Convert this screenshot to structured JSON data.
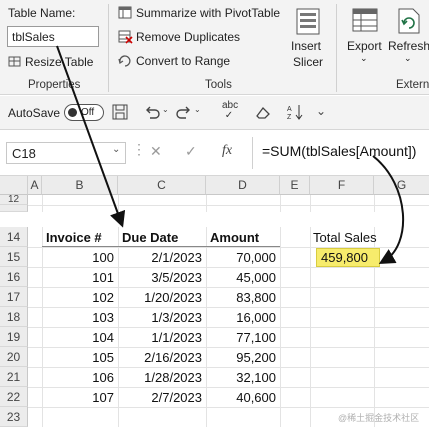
{
  "ribbon": {
    "table_name_label": "Table Name:",
    "table_name_value": "tblSales",
    "resize_table": "Resize Table",
    "properties_group": "Properties",
    "summarize_pivot": "Summarize with PivotTable",
    "remove_duplicates": "Remove Duplicates",
    "convert_to_range": "Convert to Range",
    "tools_group": "Tools",
    "insert_slicer_1": "Insert",
    "insert_slicer_2": "Slicer",
    "export": "Export",
    "refresh": "Refresh",
    "extern_group": "Extern"
  },
  "qat": {
    "autosave_label": "AutoSave",
    "autosave_state": "Off"
  },
  "formula_bar": {
    "name_box": "C18",
    "fx": "fx",
    "formula": "=SUM(tblSales[Amount])"
  },
  "columns": [
    "A",
    "B",
    "C",
    "D",
    "E",
    "F",
    "G"
  ],
  "row_numbers": [
    "12",
    "14",
    "15",
    "16",
    "17",
    "18",
    "19",
    "20",
    "21",
    "22",
    "23"
  ],
  "table": {
    "headers": [
      "Invoice #",
      "Due Date",
      "Amount"
    ],
    "rows": [
      [
        "100",
        "2/1/2023",
        "70,000"
      ],
      [
        "101",
        "3/5/2023",
        "45,000"
      ],
      [
        "102",
        "1/20/2023",
        "83,800"
      ],
      [
        "103",
        "1/3/2023",
        "16,000"
      ],
      [
        "104",
        "1/1/2023",
        "77,100"
      ],
      [
        "105",
        "2/16/2023",
        "95,200"
      ],
      [
        "106",
        "1/28/2023",
        "32,100"
      ],
      [
        "107",
        "2/7/2023",
        "40,600"
      ]
    ]
  },
  "total": {
    "label": "Total Sales",
    "value": "459,800",
    "highlight_color": "#f7ec6c"
  },
  "colors": {
    "accent": "#217346",
    "arrow": "#111111"
  },
  "icons": [
    "resize-icon",
    "pivot-icon",
    "remove-duplicates-icon",
    "convert-icon",
    "slicer-icon",
    "export-icon",
    "refresh-icon",
    "save-icon",
    "undo-icon",
    "redo-icon",
    "spelling-icon",
    "clear-icon",
    "sort-icon",
    "cancel-icon",
    "enter-icon",
    "fx-icon"
  ],
  "watermark": "@稀土掘金技术社区"
}
